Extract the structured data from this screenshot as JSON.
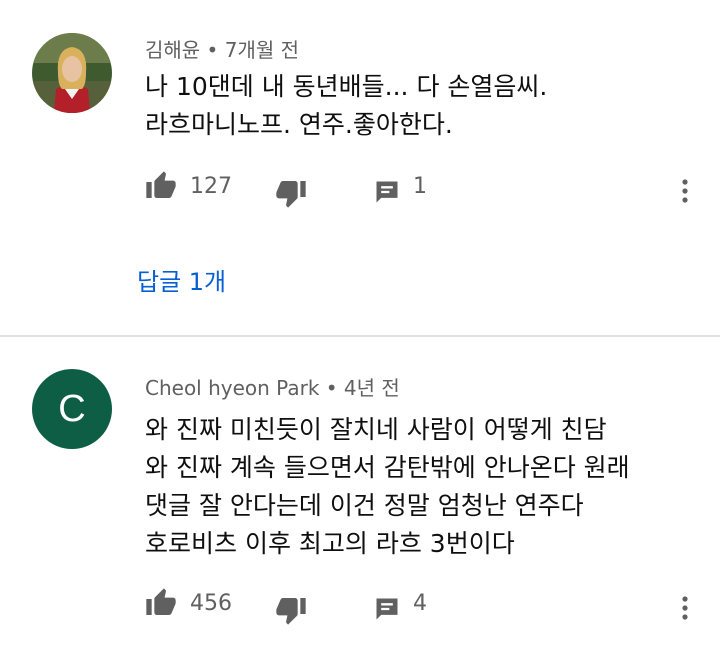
{
  "comments": [
    {
      "author": "김해윤",
      "separator": " • ",
      "time": "7개월 전",
      "text": "나 10댄데 내 동년배들... 다 손열음씨.\n라흐마니노프. 연주.좋아한다.",
      "likes": "127",
      "replies_count": "1",
      "replies_link": "답글 1개",
      "avatar": {
        "type": "photo"
      }
    },
    {
      "author": "Cheol hyeon Park",
      "separator": " • ",
      "time": "4년 전",
      "text": "와 진짜 미친듯이 잘치네 사람이 어떻게 친담\n와 진짜 계속 들으면서 감탄밖에 안나온다 원래\n댓글 잘 안다는데 이건 정말 엄청난 연주다\n호로비츠 이후 최고의 라흐 3번이다",
      "likes": "456",
      "replies_count": "4",
      "avatar": {
        "type": "letter",
        "letter": "C",
        "color": "#0d5e45"
      }
    }
  ],
  "icons": {
    "like": "thumb-up-icon",
    "dislike": "thumb-down-icon",
    "reply": "comment-icon",
    "menu": "more-vertical-icon"
  },
  "colors": {
    "link": "#065fd4",
    "meta": "#606060",
    "icon": "#606060"
  }
}
